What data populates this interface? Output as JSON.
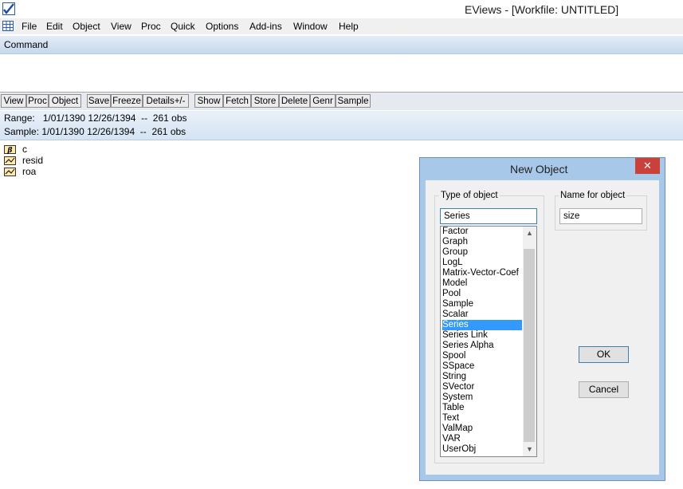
{
  "window": {
    "title": "EViews - [Workfile: UNTITLED]"
  },
  "menu": [
    "File",
    "Edit",
    "Object",
    "View",
    "Proc",
    "Quick",
    "Options",
    "Add-ins",
    "Window",
    "Help"
  ],
  "command": {
    "label": "Command"
  },
  "toolbar": [
    "View",
    "Proc",
    "Object",
    "Save",
    "Freeze",
    "Details+/-",
    "Show",
    "Fetch",
    "Store",
    "Delete",
    "Genr",
    "Sample"
  ],
  "workfile": {
    "range": "Range:   1/01/1390 12/26/1394  --  261 obs",
    "sample": "Sample: 1/01/1390 12/26/1394  --  261 obs",
    "objects": [
      {
        "name": "c",
        "icon": "coefficient-icon"
      },
      {
        "name": "resid",
        "icon": "series-icon"
      },
      {
        "name": "roa",
        "icon": "series-icon"
      }
    ]
  },
  "dialog": {
    "title": "New Object",
    "close_label": "✕",
    "type_group_label": "Type of object",
    "type_value": "Series",
    "name_group_label": "Name for object",
    "name_value": "size",
    "types": [
      "Factor",
      "Graph",
      "Group",
      "LogL",
      "Matrix-Vector-Coef",
      "Model",
      "Pool",
      "Sample",
      "Scalar",
      "Series",
      "Series Link",
      "Series Alpha",
      "Spool",
      "SSpace",
      "String",
      "SVector",
      "System",
      "Table",
      "Text",
      "ValMap",
      "VAR",
      "UserObj"
    ],
    "selected_type": "Series",
    "ok_label": "OK",
    "cancel_label": "Cancel"
  },
  "colors": {
    "selection": "#3399ff",
    "dialog_frame": "#a8c8ea",
    "close_button": "#c9413a"
  }
}
